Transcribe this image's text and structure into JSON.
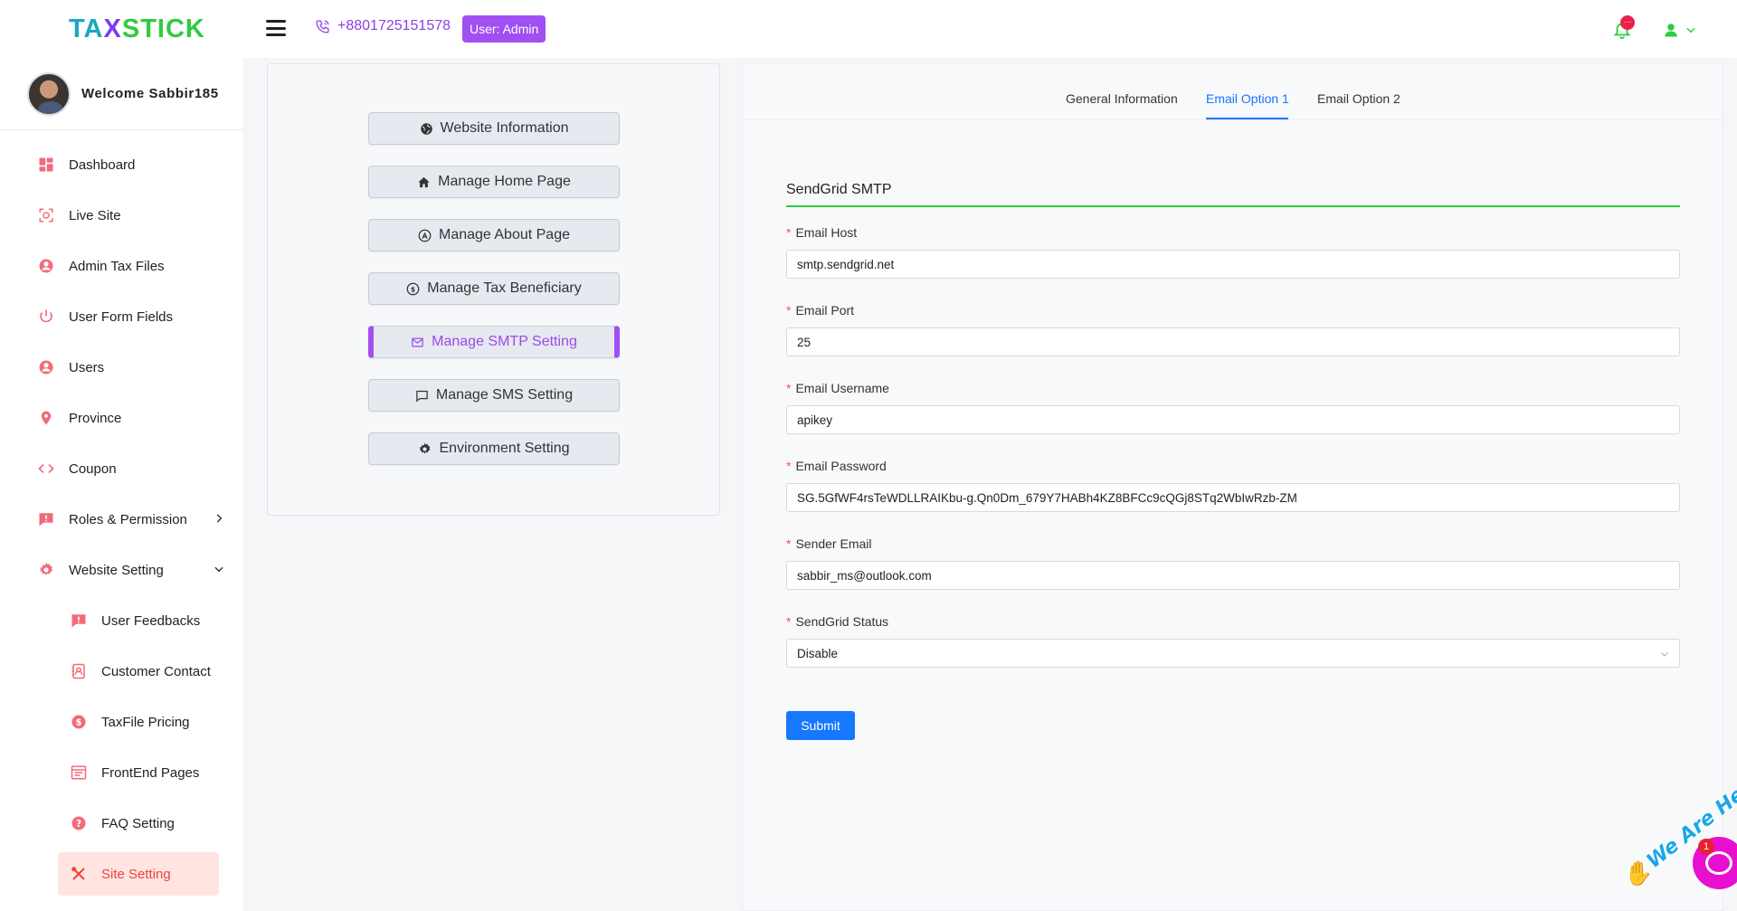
{
  "header": {
    "logo": {
      "part1": "TA",
      "part2": "X",
      "part3": "STICK"
    },
    "phone": "+8801725151578",
    "user_badge": "User:  Admin",
    "notification_badge": "···"
  },
  "sidebar": {
    "welcome": "Welcome Sabbir185",
    "items": [
      {
        "label": "Dashboard",
        "icon": "dashboard-icon"
      },
      {
        "label": "Live Site",
        "icon": "live-site-icon"
      },
      {
        "label": "Admin Tax Files",
        "icon": "user-circle-icon"
      },
      {
        "label": "User Form Fields",
        "icon": "power-icon"
      },
      {
        "label": "Users",
        "icon": "user-circle-icon"
      },
      {
        "label": "Province",
        "icon": "location-pin-icon"
      },
      {
        "label": "Coupon",
        "icon": "code-icon"
      },
      {
        "label": "Roles & Permission",
        "icon": "alert-icon"
      },
      {
        "label": "Website Setting",
        "icon": "gear-icon"
      }
    ],
    "sub_items": [
      {
        "label": "User Feedbacks",
        "icon": "feedback-icon"
      },
      {
        "label": "Customer Contact",
        "icon": "contact-book-icon"
      },
      {
        "label": "TaxFile Pricing",
        "icon": "dollar-icon"
      },
      {
        "label": "FrontEnd Pages",
        "icon": "pages-icon"
      },
      {
        "label": "FAQ Setting",
        "icon": "question-icon"
      },
      {
        "label": "Site Setting",
        "icon": "tools-icon"
      }
    ]
  },
  "menu": {
    "buttons": [
      {
        "label": "Website Information",
        "icon": "globe-icon"
      },
      {
        "label": "Manage Home Page",
        "icon": "home-icon"
      },
      {
        "label": "Manage About Page",
        "icon": "app-store-icon"
      },
      {
        "label": "Manage Tax Beneficiary",
        "icon": "dollar-circle-icon"
      },
      {
        "label": "Manage SMTP Setting",
        "icon": "mail-icon"
      },
      {
        "label": "Manage SMS Setting",
        "icon": "message-icon"
      },
      {
        "label": "Environment Setting",
        "icon": "settings-icon"
      }
    ]
  },
  "tabs": [
    "General Information",
    "Email Option 1",
    "Email Option 2"
  ],
  "form": {
    "section_title": "SendGrid SMTP",
    "fields": [
      {
        "label": "Email Host",
        "value": "smtp.sendgrid.net"
      },
      {
        "label": "Email Port",
        "value": "25"
      },
      {
        "label": "Email Username",
        "value": "apikey"
      },
      {
        "label": "Email Password",
        "value": "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"
      },
      {
        "label": "Sender Email",
        "value": "sabbir_ms@outlook.com"
      }
    ],
    "status_label": "SendGrid Status",
    "status_value": "Disable",
    "required_mark": "*",
    "submit": "Submit"
  },
  "chat": {
    "text": "We Are Here!",
    "badge": "1"
  },
  "colors": {
    "accent": "#a04ff2",
    "primary": "#1677ff",
    "danger": "#e8453c",
    "green": "#2ecc40"
  }
}
